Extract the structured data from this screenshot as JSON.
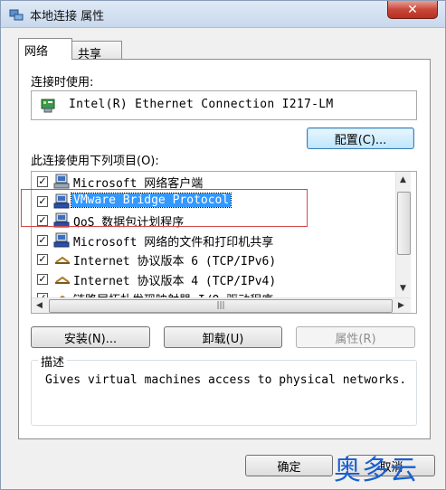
{
  "window": {
    "title": "本地连接 属性",
    "close_glyph": "✕"
  },
  "tabs": [
    {
      "label": "网络",
      "active": true
    },
    {
      "label": "共享",
      "active": false
    }
  ],
  "connect_using": {
    "label": "连接时使用:",
    "adapter": "Intel(R) Ethernet Connection I217-LM",
    "configure_button": "配置(C)..."
  },
  "items_section": {
    "label": "此连接使用下列项目(O):",
    "items": [
      {
        "text": "Microsoft 网络客户端",
        "checked": true,
        "icon": "network-client-icon",
        "selected": false
      },
      {
        "text": "VMware Bridge Protocol",
        "checked": true,
        "icon": "network-protocol-icon",
        "selected": true
      },
      {
        "text": "QoS 数据包计划程序",
        "checked": true,
        "icon": "network-service-icon",
        "selected": false
      },
      {
        "text": "Microsoft 网络的文件和打印机共享",
        "checked": true,
        "icon": "network-service-icon",
        "selected": false
      },
      {
        "text": "Internet 协议版本 6 (TCP/IPv6)",
        "checked": true,
        "icon": "protocol-icon",
        "selected": false
      },
      {
        "text": "Internet 协议版本 4 (TCP/IPv4)",
        "checked": true,
        "icon": "protocol-icon",
        "selected": false
      },
      {
        "text": "链路层拓扑发现映射器 I/O 驱动程序",
        "checked": true,
        "icon": "protocol-icon",
        "selected": false
      }
    ],
    "scroll_grip": "|||"
  },
  "buttons": {
    "install": "安装(N)...",
    "uninstall": "卸载(U)",
    "properties": "属性(R)",
    "ok": "确定",
    "cancel": "取消"
  },
  "description": {
    "title": "描述",
    "text": "Gives virtual machines access to physical networks."
  },
  "watermark": "奥多云",
  "colors": {
    "selection": "#3399ff",
    "highlight_box": "#d24a4a",
    "watermark": "#1a5fcf"
  }
}
